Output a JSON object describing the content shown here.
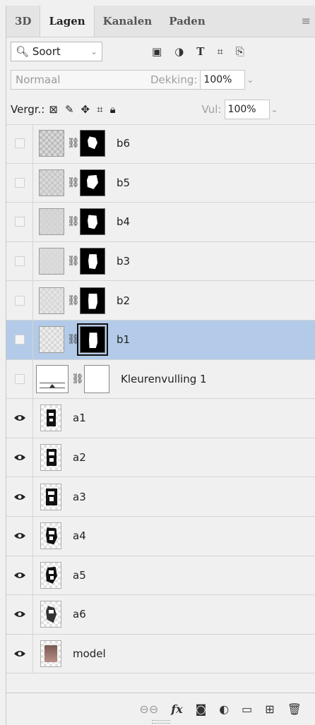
{
  "tabs": [
    {
      "label": "3D"
    },
    {
      "label": "Lagen"
    },
    {
      "label": "Kanalen"
    },
    {
      "label": "Paden"
    }
  ],
  "tab_menu_icon": "≡",
  "filter": {
    "value": "Soort"
  },
  "blend": {
    "value": "Normaal",
    "opacity_label": "Dekking:",
    "opacity_value": "100%"
  },
  "lock": {
    "label": "Vergr.:",
    "fill_label": "Vul:",
    "fill_value": "100%"
  },
  "layers": [
    {
      "name": "b6",
      "visible": false
    },
    {
      "name": "b5",
      "visible": false
    },
    {
      "name": "b4",
      "visible": false
    },
    {
      "name": "b3",
      "visible": false
    },
    {
      "name": "b2",
      "visible": false
    },
    {
      "name": "b1",
      "visible": false,
      "selected": true
    },
    {
      "name": "Kleurenvulling 1",
      "visible": false
    },
    {
      "name": "a1",
      "visible": true
    },
    {
      "name": "a2",
      "visible": true
    },
    {
      "name": "a3",
      "visible": true
    },
    {
      "name": "a4",
      "visible": true
    },
    {
      "name": "a5",
      "visible": true
    },
    {
      "name": "a6",
      "visible": true
    },
    {
      "name": "model",
      "visible": true
    }
  ],
  "colors": {
    "selected_row": "#b3cbe8",
    "panel_bg": "#f0f0f0"
  }
}
